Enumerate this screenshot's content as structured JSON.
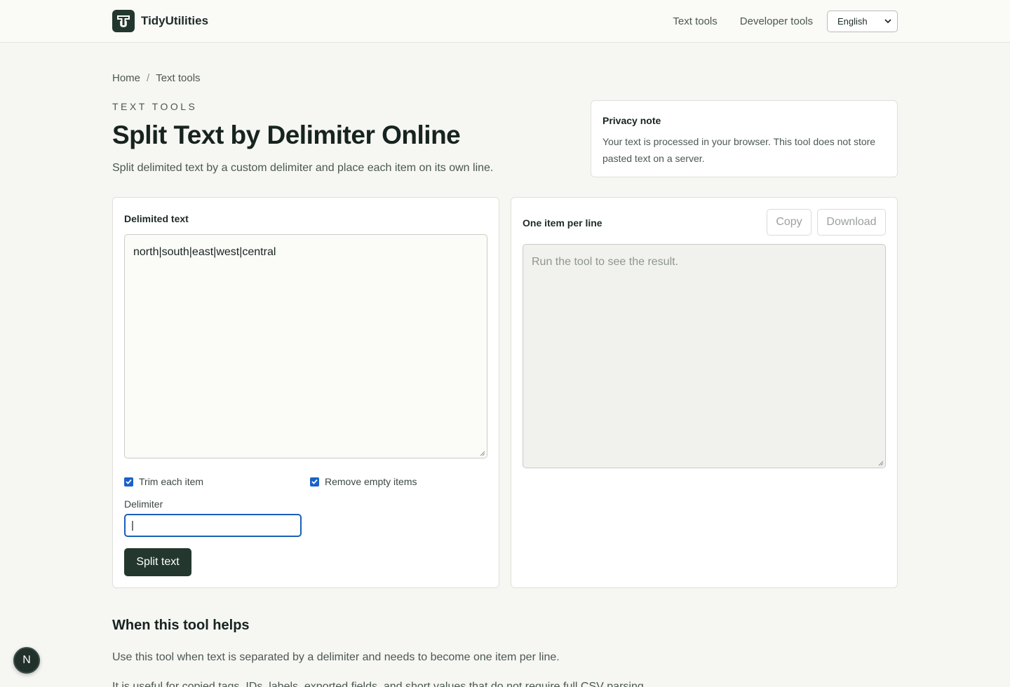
{
  "header": {
    "brand": "TidyUtilities",
    "nav": [
      "Text tools",
      "Developer tools"
    ],
    "language": "English"
  },
  "breadcrumb": {
    "home": "Home",
    "separator": "/",
    "current": "Text tools"
  },
  "hero": {
    "eyebrow": "TEXT TOOLS",
    "title": "Split Text by Delimiter Online",
    "subtitle": "Split delimited text by a custom delimiter and place each item on its own line."
  },
  "privacy": {
    "title": "Privacy note",
    "body": "Your text is processed in your browser. This tool does not store pasted text on a server."
  },
  "input_card": {
    "label": "Delimited text",
    "text": "north|south|east|west|central",
    "trim_label": "Trim each item",
    "trim_checked": true,
    "remove_empty_label": "Remove empty items",
    "remove_empty_checked": true,
    "delimiter_label": "Delimiter",
    "delimiter_value": "|",
    "split_button": "Split text"
  },
  "output_card": {
    "label": "One item per line",
    "copy_button": "Copy",
    "download_button": "Download",
    "placeholder": "Run the tool to see the result."
  },
  "info": {
    "title": "When this tool helps",
    "para1": "Use this tool when text is separated by a delimiter and needs to become one item per line.",
    "para2": "It is useful for copied tags, IDs, labels, exported fields, and short values that do not require full CSV parsing."
  },
  "fab": {
    "label": "N"
  },
  "colors": {
    "brand": "#23372f",
    "accent": "#1a62c9",
    "background": "#f6f6f3"
  }
}
